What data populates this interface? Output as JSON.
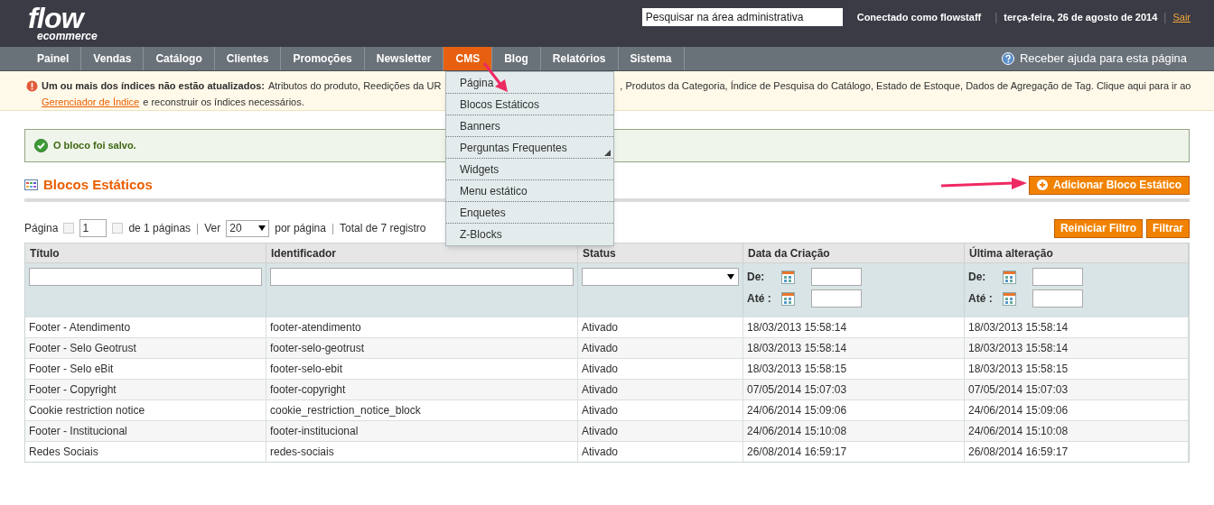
{
  "header": {
    "logo": {
      "main": "flow",
      "sub": "ecommerce"
    },
    "search": {
      "placeholder": "Pesquisar na área administrativa"
    },
    "user": "Conectado como flowstaff",
    "separator_1": "|",
    "date": "terça-feira, 26 de agosto de 2014",
    "separator_2": "|",
    "logout": "Sair"
  },
  "nav": {
    "items": [
      {
        "label": "Painel",
        "selected": false
      },
      {
        "label": "Vendas",
        "selected": false
      },
      {
        "label": "Catálogo",
        "selected": false
      },
      {
        "label": "Clientes",
        "selected": false
      },
      {
        "label": "Promoções",
        "selected": false
      },
      {
        "label": "Newsletter",
        "selected": false
      },
      {
        "label": "CMS",
        "selected": true
      },
      {
        "label": "Blog",
        "selected": false
      },
      {
        "label": "Relatórios",
        "selected": false
      },
      {
        "label": "Sistema",
        "selected": false
      }
    ],
    "help": "Receber ajuda para esta página"
  },
  "cms_menu": [
    {
      "label": "Página",
      "submenu": false
    },
    {
      "label": "Blocos Estáticos",
      "submenu": false
    },
    {
      "label": "Banners",
      "submenu": false
    },
    {
      "label": "Perguntas Frequentes",
      "submenu": true
    },
    {
      "label": "Widgets",
      "submenu": false
    },
    {
      "label": "Menu estático",
      "submenu": false
    },
    {
      "label": "Enquetes",
      "submenu": false
    },
    {
      "label": "Z-Blocks",
      "submenu": false
    }
  ],
  "notice": {
    "title": "Um ou mais dos índices não estão atualizados:",
    "text_before": "Atributos do produto, Reedições da UR",
    "text_after": ", Produtos da Categoria, Índice de Pesquisa do Catálogo, Estado de Estoque, Dados de Agregação de Tag. Clique aqui para ir ao",
    "link": "Gerenciador de Índice",
    "text_end": "e reconstruir os índices necessários."
  },
  "success": "O bloco foi salvo.",
  "page_title": "Blocos Estáticos",
  "add_button": "Adicionar Bloco Estático",
  "pager": {
    "page_label": "Página",
    "page": "1",
    "of_pages": "de 1 páginas",
    "separator_1": "|",
    "view_label": "Ver",
    "per_page": "20",
    "per_page_label": "por página",
    "separator_2": "|",
    "total": "Total de 7 registro"
  },
  "grid_buttons": [
    "Reiniciar Filtro",
    "Filtrar"
  ],
  "table": {
    "columns": [
      {
        "label": "Título",
        "kind": "text"
      },
      {
        "label": "Identificador",
        "kind": "text"
      },
      {
        "label": "Status",
        "kind": "select"
      },
      {
        "label": "Data da Criação",
        "kind": "date_range",
        "date_labels": [
          "De:",
          "Até :"
        ]
      },
      {
        "label": "Última alteração",
        "kind": "date_range",
        "date_labels": [
          "De:",
          "Até :"
        ]
      }
    ],
    "rows": [
      [
        "Footer - Atendimento",
        "footer-atendimento",
        "Ativado",
        "18/03/2013 15:58:14",
        "18/03/2013 15:58:14"
      ],
      [
        "Footer - Selo Geotrust",
        "footer-selo-geotrust",
        "Ativado",
        "18/03/2013 15:58:14",
        "18/03/2013 15:58:14"
      ],
      [
        "Footer - Selo eBit",
        "footer-selo-ebit",
        "Ativado",
        "18/03/2013 15:58:15",
        "18/03/2013 15:58:15"
      ],
      [
        "Footer - Copyright",
        "footer-copyright",
        "Ativado",
        "07/05/2014 15:07:03",
        "07/05/2014 15:07:03"
      ],
      [
        "Cookie restriction notice",
        "cookie_restriction_notice_block",
        "Ativado",
        "24/06/2014 15:09:06",
        "24/06/2014 15:09:06"
      ],
      [
        "Footer - Institucional",
        "footer-institucional",
        "Ativado",
        "24/06/2014 15:10:08",
        "24/06/2014 15:10:08"
      ],
      [
        "Redes Sociais",
        "redes-sociais",
        "Ativado",
        "26/08/2014 16:59:17",
        "26/08/2014 16:59:17"
      ]
    ]
  }
}
